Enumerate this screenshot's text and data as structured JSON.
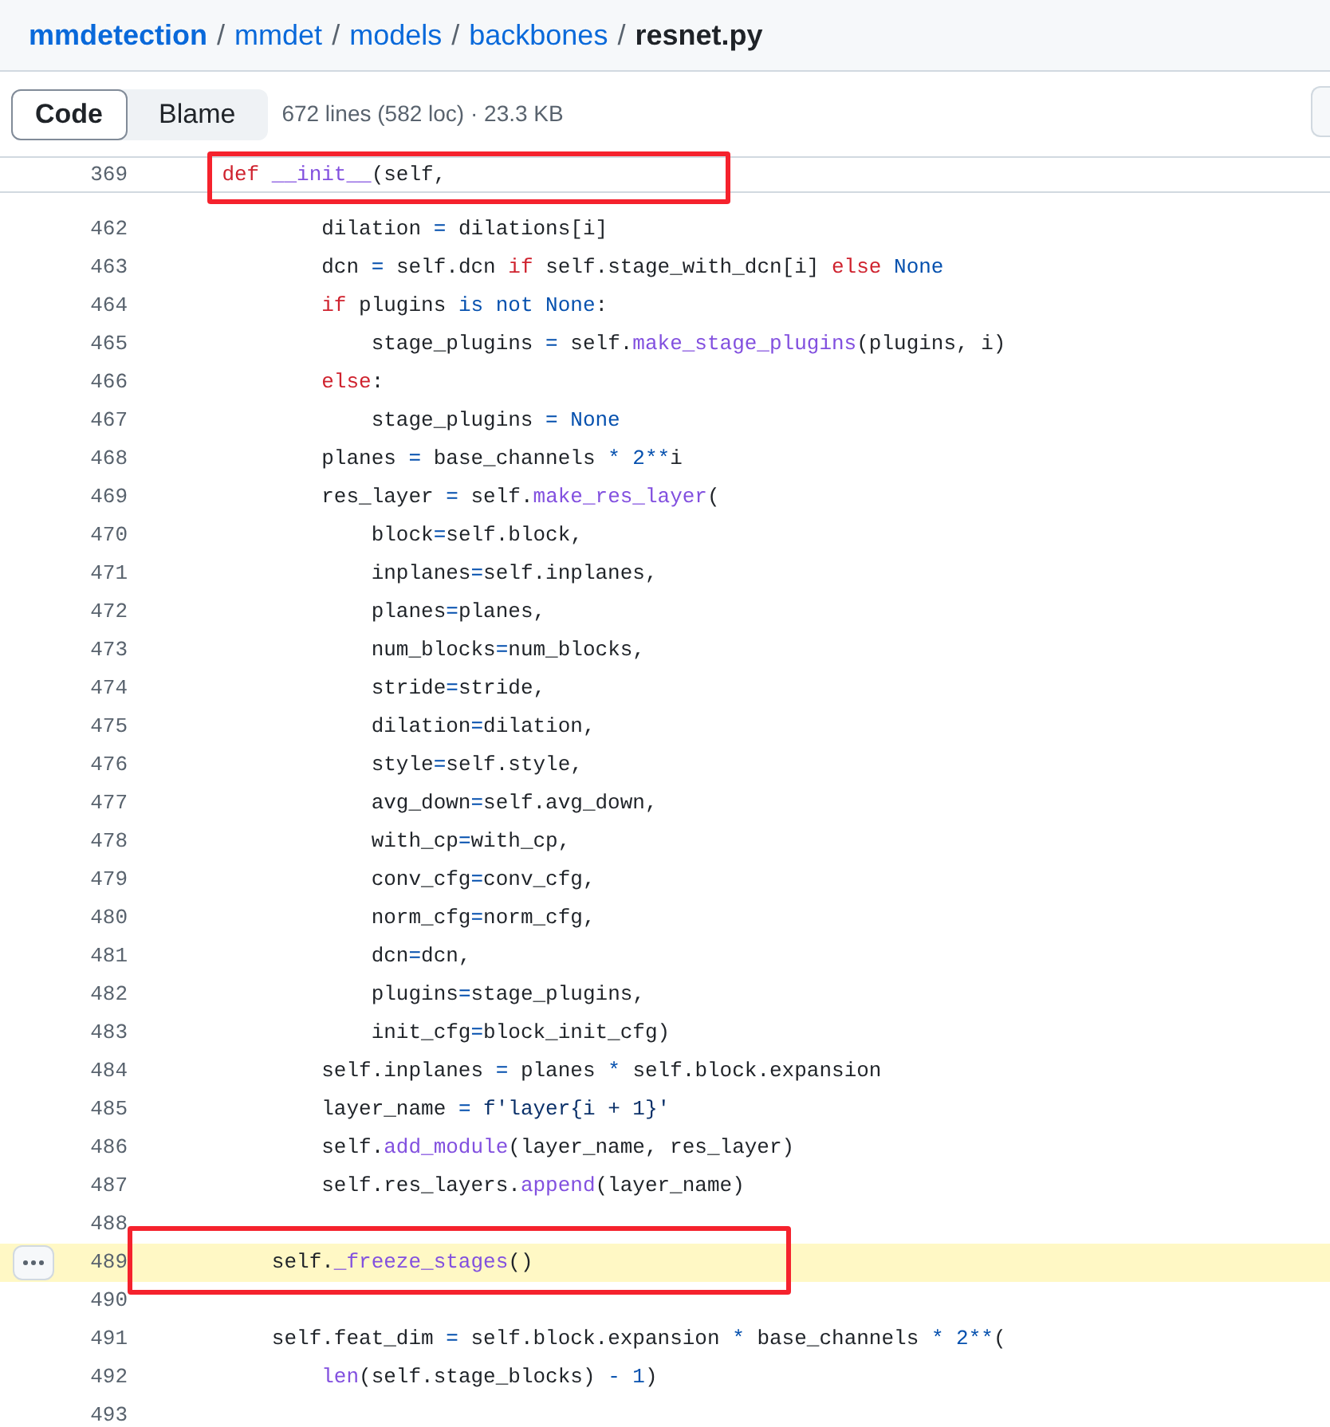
{
  "breadcrumb": [
    {
      "text": "mmdetection",
      "kind": "repo"
    },
    {
      "text": "/",
      "kind": "separator"
    },
    {
      "text": "mmdet",
      "kind": "folder"
    },
    {
      "text": "/",
      "kind": "separator"
    },
    {
      "text": "models",
      "kind": "folder"
    },
    {
      "text": "/",
      "kind": "separator"
    },
    {
      "text": "backbones",
      "kind": "folder"
    },
    {
      "text": "/",
      "kind": "separator"
    },
    {
      "text": "resnet.py",
      "kind": "file"
    }
  ],
  "view_tabs": [
    {
      "label": "Code",
      "selected": true
    },
    {
      "label": "Blame",
      "selected": false
    }
  ],
  "file_info": "672 lines (582 loc) · 23.3 KB",
  "sticky_line": {
    "number": "369",
    "annotated": true,
    "tokens": [
      {
        "text": "    def",
        "kind": "keyword"
      },
      {
        "text": " __init__",
        "kind": "function"
      },
      {
        "text": "(self,",
        "kind": "plain"
      }
    ]
  },
  "lines": [
    {
      "number": "462",
      "highlighted": false,
      "annotated": false,
      "tokens": [
        {
          "text": "            dilation ",
          "kind": "plain"
        },
        {
          "text": "=",
          "kind": "operator"
        },
        {
          "text": " dilations[i]",
          "kind": "plain"
        }
      ]
    },
    {
      "number": "463",
      "highlighted": false,
      "annotated": false,
      "tokens": [
        {
          "text": "            dcn ",
          "kind": "plain"
        },
        {
          "text": "=",
          "kind": "operator"
        },
        {
          "text": " self.dcn ",
          "kind": "plain"
        },
        {
          "text": "if",
          "kind": "keyword"
        },
        {
          "text": " self.stage_with_dcn[i] ",
          "kind": "plain"
        },
        {
          "text": "else",
          "kind": "keyword"
        },
        {
          "text": " None",
          "kind": "constant"
        }
      ]
    },
    {
      "number": "464",
      "highlighted": false,
      "annotated": false,
      "tokens": [
        {
          "text": "            if",
          "kind": "keyword"
        },
        {
          "text": " plugins ",
          "kind": "plain"
        },
        {
          "text": "is not None",
          "kind": "operator"
        },
        {
          "text": ":",
          "kind": "plain"
        }
      ]
    },
    {
      "number": "465",
      "highlighted": false,
      "annotated": false,
      "tokens": [
        {
          "text": "                stage_plugins ",
          "kind": "plain"
        },
        {
          "text": "=",
          "kind": "operator"
        },
        {
          "text": " self.",
          "kind": "plain"
        },
        {
          "text": "make_stage_plugins",
          "kind": "function"
        },
        {
          "text": "(plugins, i)",
          "kind": "plain"
        }
      ]
    },
    {
      "number": "466",
      "highlighted": false,
      "annotated": false,
      "tokens": [
        {
          "text": "            else",
          "kind": "keyword"
        },
        {
          "text": ":",
          "kind": "plain"
        }
      ]
    },
    {
      "number": "467",
      "highlighted": false,
      "annotated": false,
      "tokens": [
        {
          "text": "                stage_plugins ",
          "kind": "plain"
        },
        {
          "text": "= None",
          "kind": "constant"
        }
      ]
    },
    {
      "number": "468",
      "highlighted": false,
      "annotated": false,
      "tokens": [
        {
          "text": "            planes ",
          "kind": "plain"
        },
        {
          "text": "=",
          "kind": "operator"
        },
        {
          "text": " base_channels ",
          "kind": "plain"
        },
        {
          "text": "* 2**",
          "kind": "constant"
        },
        {
          "text": "i",
          "kind": "plain"
        }
      ]
    },
    {
      "number": "469",
      "highlighted": false,
      "annotated": false,
      "tokens": [
        {
          "text": "            res_layer ",
          "kind": "plain"
        },
        {
          "text": "=",
          "kind": "operator"
        },
        {
          "text": " self.",
          "kind": "plain"
        },
        {
          "text": "make_res_layer",
          "kind": "function"
        },
        {
          "text": "(",
          "kind": "plain"
        }
      ]
    },
    {
      "number": "470",
      "highlighted": false,
      "annotated": false,
      "tokens": [
        {
          "text": "                block",
          "kind": "plain"
        },
        {
          "text": "=",
          "kind": "operator"
        },
        {
          "text": "self.block,",
          "kind": "plain"
        }
      ]
    },
    {
      "number": "471",
      "highlighted": false,
      "annotated": false,
      "tokens": [
        {
          "text": "                inplanes",
          "kind": "plain"
        },
        {
          "text": "=",
          "kind": "operator"
        },
        {
          "text": "self.inplanes,",
          "kind": "plain"
        }
      ]
    },
    {
      "number": "472",
      "highlighted": false,
      "annotated": false,
      "tokens": [
        {
          "text": "                planes",
          "kind": "plain"
        },
        {
          "text": "=",
          "kind": "operator"
        },
        {
          "text": "planes,",
          "kind": "plain"
        }
      ]
    },
    {
      "number": "473",
      "highlighted": false,
      "annotated": false,
      "tokens": [
        {
          "text": "                num_blocks",
          "kind": "plain"
        },
        {
          "text": "=",
          "kind": "operator"
        },
        {
          "text": "num_blocks,",
          "kind": "plain"
        }
      ]
    },
    {
      "number": "474",
      "highlighted": false,
      "annotated": false,
      "tokens": [
        {
          "text": "                stride",
          "kind": "plain"
        },
        {
          "text": "=",
          "kind": "operator"
        },
        {
          "text": "stride,",
          "kind": "plain"
        }
      ]
    },
    {
      "number": "475",
      "highlighted": false,
      "annotated": false,
      "tokens": [
        {
          "text": "                dilation",
          "kind": "plain"
        },
        {
          "text": "=",
          "kind": "operator"
        },
        {
          "text": "dilation,",
          "kind": "plain"
        }
      ]
    },
    {
      "number": "476",
      "highlighted": false,
      "annotated": false,
      "tokens": [
        {
          "text": "                style",
          "kind": "plain"
        },
        {
          "text": "=",
          "kind": "operator"
        },
        {
          "text": "self.style,",
          "kind": "plain"
        }
      ]
    },
    {
      "number": "477",
      "highlighted": false,
      "annotated": false,
      "tokens": [
        {
          "text": "                avg_down",
          "kind": "plain"
        },
        {
          "text": "=",
          "kind": "operator"
        },
        {
          "text": "self.avg_down,",
          "kind": "plain"
        }
      ]
    },
    {
      "number": "478",
      "highlighted": false,
      "annotated": false,
      "tokens": [
        {
          "text": "                with_cp",
          "kind": "plain"
        },
        {
          "text": "=",
          "kind": "operator"
        },
        {
          "text": "with_cp,",
          "kind": "plain"
        }
      ]
    },
    {
      "number": "479",
      "highlighted": false,
      "annotated": false,
      "tokens": [
        {
          "text": "                conv_cfg",
          "kind": "plain"
        },
        {
          "text": "=",
          "kind": "operator"
        },
        {
          "text": "conv_cfg,",
          "kind": "plain"
        }
      ]
    },
    {
      "number": "480",
      "highlighted": false,
      "annotated": false,
      "tokens": [
        {
          "text": "                norm_cfg",
          "kind": "plain"
        },
        {
          "text": "=",
          "kind": "operator"
        },
        {
          "text": "norm_cfg,",
          "kind": "plain"
        }
      ]
    },
    {
      "number": "481",
      "highlighted": false,
      "annotated": false,
      "tokens": [
        {
          "text": "                dcn",
          "kind": "plain"
        },
        {
          "text": "=",
          "kind": "operator"
        },
        {
          "text": "dcn,",
          "kind": "plain"
        }
      ]
    },
    {
      "number": "482",
      "highlighted": false,
      "annotated": false,
      "tokens": [
        {
          "text": "                plugins",
          "kind": "plain"
        },
        {
          "text": "=",
          "kind": "operator"
        },
        {
          "text": "stage_plugins,",
          "kind": "plain"
        }
      ]
    },
    {
      "number": "483",
      "highlighted": false,
      "annotated": false,
      "tokens": [
        {
          "text": "                init_cfg",
          "kind": "plain"
        },
        {
          "text": "=",
          "kind": "operator"
        },
        {
          "text": "block_init_cfg)",
          "kind": "plain"
        }
      ]
    },
    {
      "number": "484",
      "highlighted": false,
      "annotated": false,
      "tokens": [
        {
          "text": "            self.inplanes ",
          "kind": "plain"
        },
        {
          "text": "=",
          "kind": "operator"
        },
        {
          "text": " planes ",
          "kind": "plain"
        },
        {
          "text": "*",
          "kind": "operator"
        },
        {
          "text": " self.block.expansion",
          "kind": "plain"
        }
      ]
    },
    {
      "number": "485",
      "highlighted": false,
      "annotated": false,
      "tokens": [
        {
          "text": "            layer_name ",
          "kind": "plain"
        },
        {
          "text": "=",
          "kind": "operator"
        },
        {
          "text": " f'layer{i + 1}'",
          "kind": "string"
        }
      ]
    },
    {
      "number": "486",
      "highlighted": false,
      "annotated": false,
      "tokens": [
        {
          "text": "            self.",
          "kind": "plain"
        },
        {
          "text": "add_module",
          "kind": "function"
        },
        {
          "text": "(layer_name, res_layer)",
          "kind": "plain"
        }
      ]
    },
    {
      "number": "487",
      "highlighted": false,
      "annotated": false,
      "tokens": [
        {
          "text": "            self.res_layers.",
          "kind": "plain"
        },
        {
          "text": "append",
          "kind": "function"
        },
        {
          "text": "(layer_name)",
          "kind": "plain"
        }
      ]
    },
    {
      "number": "488",
      "highlighted": false,
      "annotated": false
    },
    {
      "number": "489",
      "highlighted": true,
      "annotated": true,
      "tokens": [
        {
          "text": "        self.",
          "kind": "plain"
        },
        {
          "text": "_freeze_stages",
          "kind": "function"
        },
        {
          "text": "()",
          "kind": "plain"
        }
      ]
    },
    {
      "number": "490",
      "highlighted": false,
      "annotated": false
    },
    {
      "number": "491",
      "highlighted": false,
      "annotated": false,
      "tokens": [
        {
          "text": "        self.feat_dim ",
          "kind": "plain"
        },
        {
          "text": "=",
          "kind": "operator"
        },
        {
          "text": " self.block.expansion ",
          "kind": "plain"
        },
        {
          "text": "*",
          "kind": "operator"
        },
        {
          "text": " base_channels ",
          "kind": "plain"
        },
        {
          "text": "* 2**",
          "kind": "constant"
        },
        {
          "text": "(",
          "kind": "plain"
        }
      ]
    },
    {
      "number": "492",
      "highlighted": false,
      "annotated": false,
      "tokens": [
        {
          "text": "            len",
          "kind": "function"
        },
        {
          "text": "(self.stage_blocks) ",
          "kind": "plain"
        },
        {
          "text": "- 1",
          "kind": "constant"
        },
        {
          "text": ")",
          "kind": "plain"
        }
      ]
    },
    {
      "number": "493",
      "highlighted": false,
      "annotated": false
    }
  ]
}
